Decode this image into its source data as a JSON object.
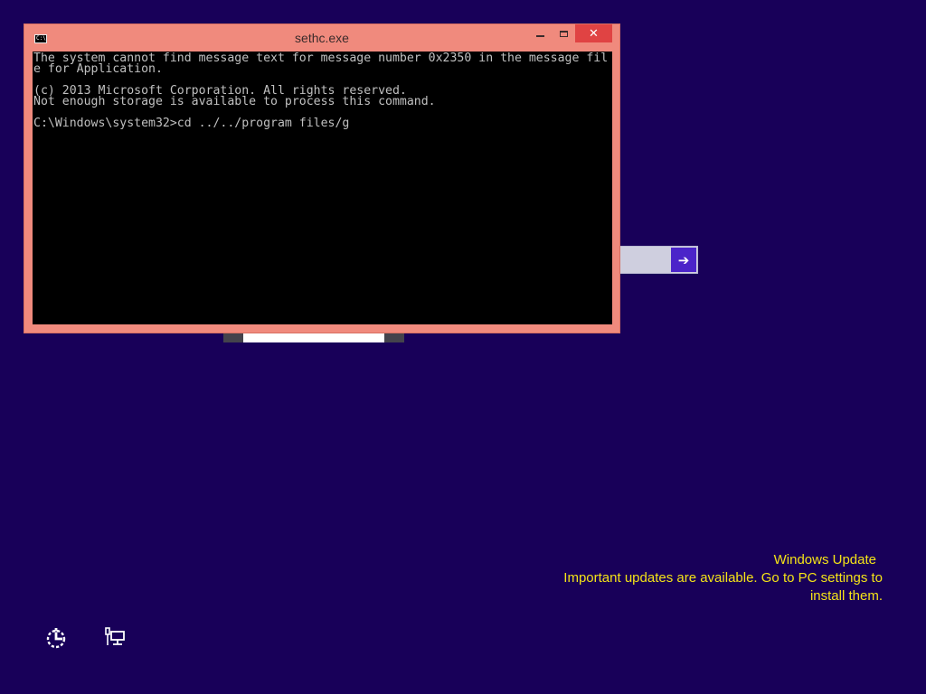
{
  "console": {
    "title": "sethc.exe",
    "icon": "cmd-icon",
    "icon_text": "C:\\",
    "buttons": {
      "minimize": "minimize-icon",
      "maximize": "maximize-icon",
      "close_glyph": "✕"
    },
    "lines": [
      "The system cannot find message text for message number 0x2350 in the message fil",
      "e for Application.",
      "",
      "(c) 2013 Microsoft Corporation. All rights reserved.",
      "Not enough storage is available to process this command.",
      "",
      "C:\\Windows\\system32>cd ../../program files/g"
    ]
  },
  "login": {
    "submit_glyph": "➔"
  },
  "notification": {
    "title": "Windows Update",
    "line1": "Important updates are available. Go to PC settings to",
    "line2": "install them."
  },
  "bottom_bar": {
    "ease_of_access": "ease-of-access-icon",
    "network": "network-icon"
  },
  "colors": {
    "background": "#180059",
    "console_frame": "#f08a7d",
    "close_button": "#e04343",
    "notification_text": "#f5e317",
    "submit_button": "#4b24c9"
  }
}
